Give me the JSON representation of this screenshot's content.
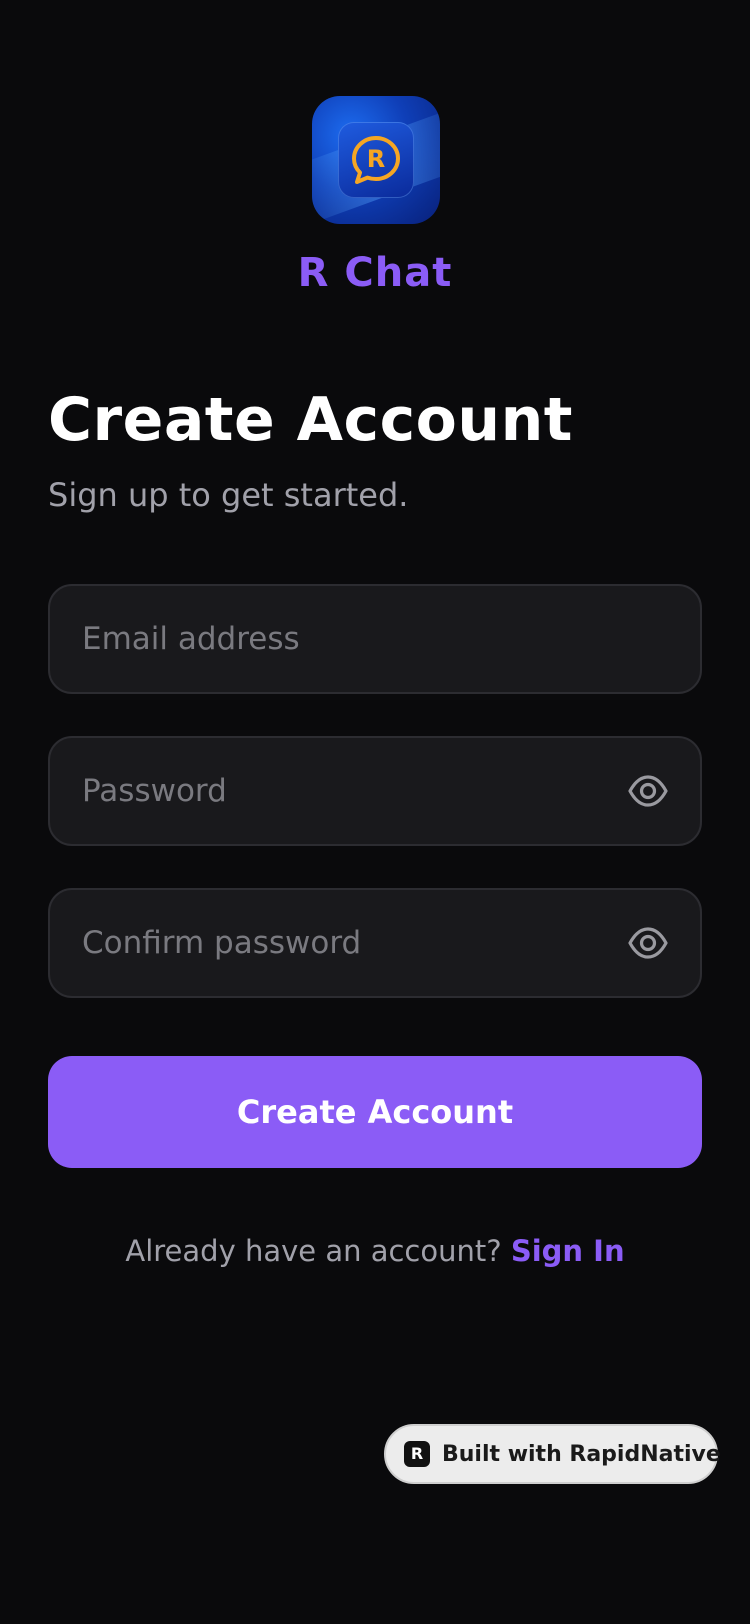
{
  "app": {
    "name": "R Chat",
    "logo_letter": "R"
  },
  "header": {
    "title": "Create Account",
    "subtitle": "Sign up to get started."
  },
  "form": {
    "email": {
      "value": "",
      "placeholder": "Email address"
    },
    "password": {
      "value": "",
      "placeholder": "Password",
      "toggle_icon": "eye-icon"
    },
    "confirm_password": {
      "value": "",
      "placeholder": "Confirm password",
      "toggle_icon": "eye-icon"
    },
    "submit_label": "Create Account"
  },
  "footer": {
    "prompt": "Already have an account?",
    "link_label": "Sign In"
  },
  "badge": {
    "label": "Built with RapidNative",
    "icon_letter": "R"
  },
  "colors": {
    "background": "#0a0a0c",
    "accent": "#8b5cf6",
    "field_bg": "#19191c",
    "muted_text": "#a1a1aa"
  }
}
